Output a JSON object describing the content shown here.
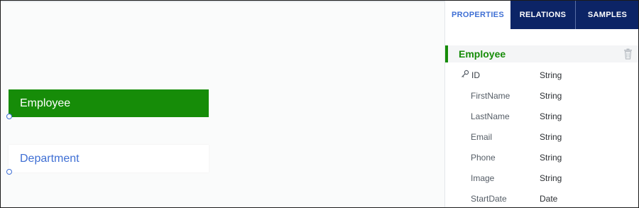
{
  "canvas": {
    "entities": [
      {
        "label": "Employee",
        "selected": true
      },
      {
        "label": "Department",
        "selected": false
      }
    ]
  },
  "panel": {
    "tabs": [
      {
        "label": "PROPERTIES",
        "active": true
      },
      {
        "label": "RELATIONS",
        "active": false
      },
      {
        "label": "SAMPLES",
        "active": false
      }
    ],
    "entity_title": "Employee",
    "fields": [
      {
        "name": "ID",
        "type": "String",
        "icon": "key-icon"
      },
      {
        "name": "FirstName",
        "type": "String"
      },
      {
        "name": "LastName",
        "type": "String"
      },
      {
        "name": "Email",
        "type": "String"
      },
      {
        "name": "Phone",
        "type": "String"
      },
      {
        "name": "Image",
        "type": "String"
      },
      {
        "name": "StartDate",
        "type": "Date"
      }
    ]
  },
  "colors": {
    "accent_green": "#168c08",
    "accent_blue": "#3f6fd4",
    "tab_dark": "#0c2466"
  }
}
